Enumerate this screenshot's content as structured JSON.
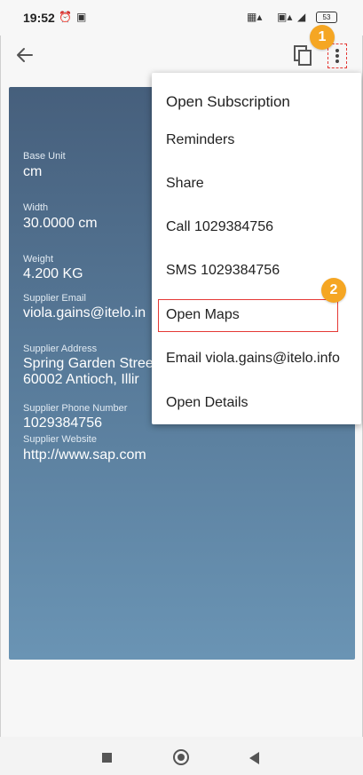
{
  "status_bar": {
    "time": "19:52",
    "icons": [
      "alarm-off-icon",
      "app-notification-icon",
      "signal-icon",
      "sim-icon",
      "wifi-icon"
    ],
    "battery": "53"
  },
  "app_bar": {
    "back_icon": "arrow-left-icon",
    "copy_icon": "copy-icon",
    "more_icon": "more-vert-icon"
  },
  "details": [
    {
      "label": "Base Unit",
      "value": "cm"
    },
    {
      "label": "Width",
      "value": "30.0000 cm"
    },
    {
      "label": "Weight",
      "value": "4.200 KG"
    },
    {
      "label": "Supplier Email",
      "value": "viola.gains@itelo.in"
    },
    {
      "label": "Supplier Address",
      "value": "Spring Garden Stree",
      "value2": "60002   Antioch, Illir"
    },
    {
      "label": "Supplier Phone Number",
      "value": "1029384756"
    },
    {
      "label": "Supplier Website",
      "value": "http://www.sap.com"
    }
  ],
  "menu": {
    "items": [
      "Open Subscription",
      "Reminders",
      "Share",
      "Call 1029384756",
      "SMS 1029384756",
      "Open Maps",
      "Email viola.gains@itelo.info",
      "Open Details"
    ]
  },
  "callouts": [
    "1",
    "2"
  ],
  "colors": {
    "card_top": "#465f7c",
    "card_bottom": "#6a94b4",
    "callout": "#f5a623",
    "highlight": "#e53935"
  }
}
